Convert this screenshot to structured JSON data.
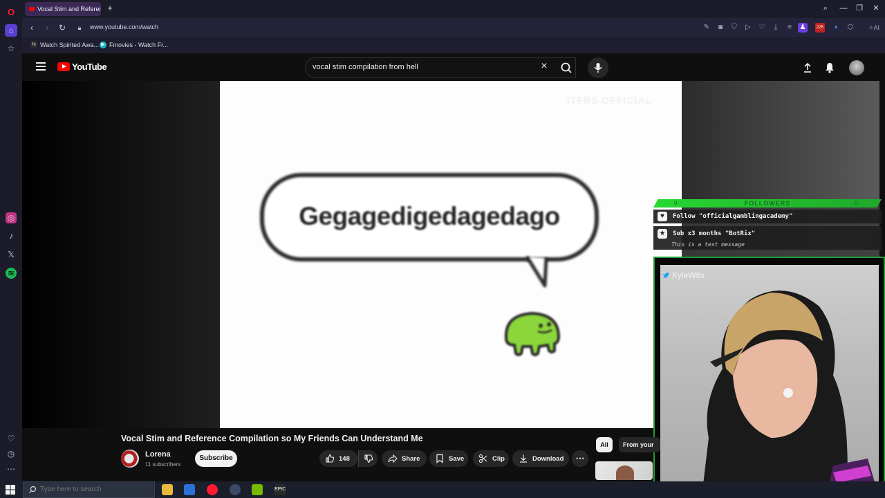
{
  "browser": {
    "tab_title": "Vocal Stim and Reference",
    "url": "www.youtube.com/watch",
    "new_tab_symbol": "+"
  },
  "bookmarks": [
    {
      "label": "Watch Spirited Awa...",
      "icon": "hi"
    },
    {
      "label": "Fmovies - Watch Fr...",
      "icon": "play"
    }
  ],
  "youtube": {
    "logo_text": "YouTube",
    "search_value": "vocal stim compilation from hell",
    "search_placeholder": "Search"
  },
  "video": {
    "watermark": "ITFRS OFFICIAL",
    "bubble_text": "Gegagedigedagedago",
    "title": "Vocal Stim and Reference Compilation so My Friends Can Understand Me",
    "channel": "Lorena",
    "subscribers": "11 subscribers",
    "subscribe_label": "Subscribe",
    "like_count": "148",
    "share_label": "Share",
    "save_label": "Save",
    "clip_label": "Clip",
    "download_label": "Download"
  },
  "chips": {
    "all": "All",
    "from": "From your"
  },
  "overlay": {
    "followers_title": "FOLLOWERS",
    "followers_left": "0",
    "followers_right": "0",
    "alert_follow": "Follow \"officialgamblingacademy\"",
    "alert_sub": "Sub x3 months \"BotRix\"",
    "alert_sub_msg": "This is a test message",
    "cam_name": "KyleWits"
  },
  "taskbar": {
    "search_placeholder": "Type here to search"
  },
  "colors": {
    "yt_red": "#ff0000",
    "overlay_green": "#27d832",
    "opera_red": "#ff1b2d"
  }
}
